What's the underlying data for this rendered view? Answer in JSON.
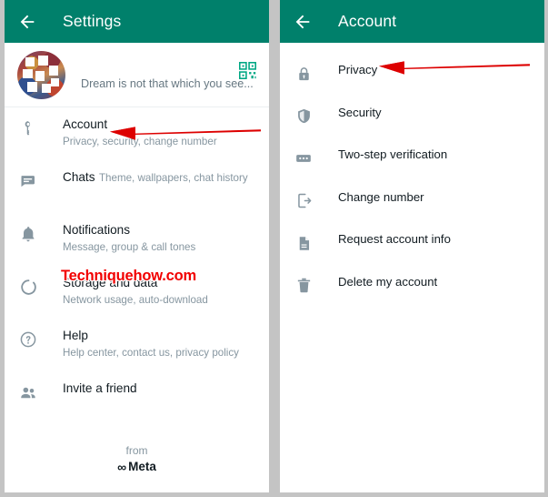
{
  "theme": {
    "appbar_green": "#00806B",
    "accent_green": "#00A884",
    "icon_gray": "#8696A0",
    "primary_text": "#111B21",
    "secondary_text": "#8696A0",
    "arrow_red": "#E00000",
    "watermark_red": "#F20000",
    "page_background": "#C4C4C4"
  },
  "left_panel": {
    "appbar": {
      "back_icon": "back-arrow-icon",
      "title": "Settings"
    },
    "profile": {
      "name": "",
      "status": "Dream is not that which you see...",
      "qr_icon": "qr-code-icon",
      "avatar_icon": "profile-avatar"
    },
    "items": [
      {
        "icon": "key-icon",
        "label": "Account",
        "sublabel": "Privacy, security, change number"
      },
      {
        "icon": "chat-icon",
        "label": "Chats",
        "sublabel": "Theme, wallpapers, chat history"
      },
      {
        "icon": "bell-icon",
        "label": "Notifications",
        "sublabel": "Message, group & call tones"
      },
      {
        "icon": "refresh-icon",
        "label": "Storage and data",
        "sublabel": "Network usage, auto-download"
      },
      {
        "icon": "help-icon",
        "label": "Help",
        "sublabel": "Help center, contact us, privacy policy"
      },
      {
        "icon": "people-icon",
        "label": "Invite a friend",
        "sublabel": ""
      }
    ],
    "footer": {
      "from": "from",
      "brand": "Meta",
      "brand_glyph": "∞"
    },
    "watermark": "Techniquehow.com"
  },
  "right_panel": {
    "appbar": {
      "back_icon": "back-arrow-icon",
      "title": "Account"
    },
    "items": [
      {
        "icon": "lock-icon",
        "label": "Privacy"
      },
      {
        "icon": "shield-icon",
        "label": "Security"
      },
      {
        "icon": "dots-box-icon",
        "label": "Two-step verification"
      },
      {
        "icon": "change-number-icon",
        "label": "Change number"
      },
      {
        "icon": "document-icon",
        "label": "Request account info"
      },
      {
        "icon": "trash-icon",
        "label": "Delete my account"
      }
    ]
  },
  "annotations": [
    {
      "name": "arrow-pointing-to-account",
      "points_to": "Account",
      "color": "#E00000"
    },
    {
      "name": "arrow-pointing-to-privacy",
      "points_to": "Privacy",
      "color": "#E00000"
    }
  ]
}
